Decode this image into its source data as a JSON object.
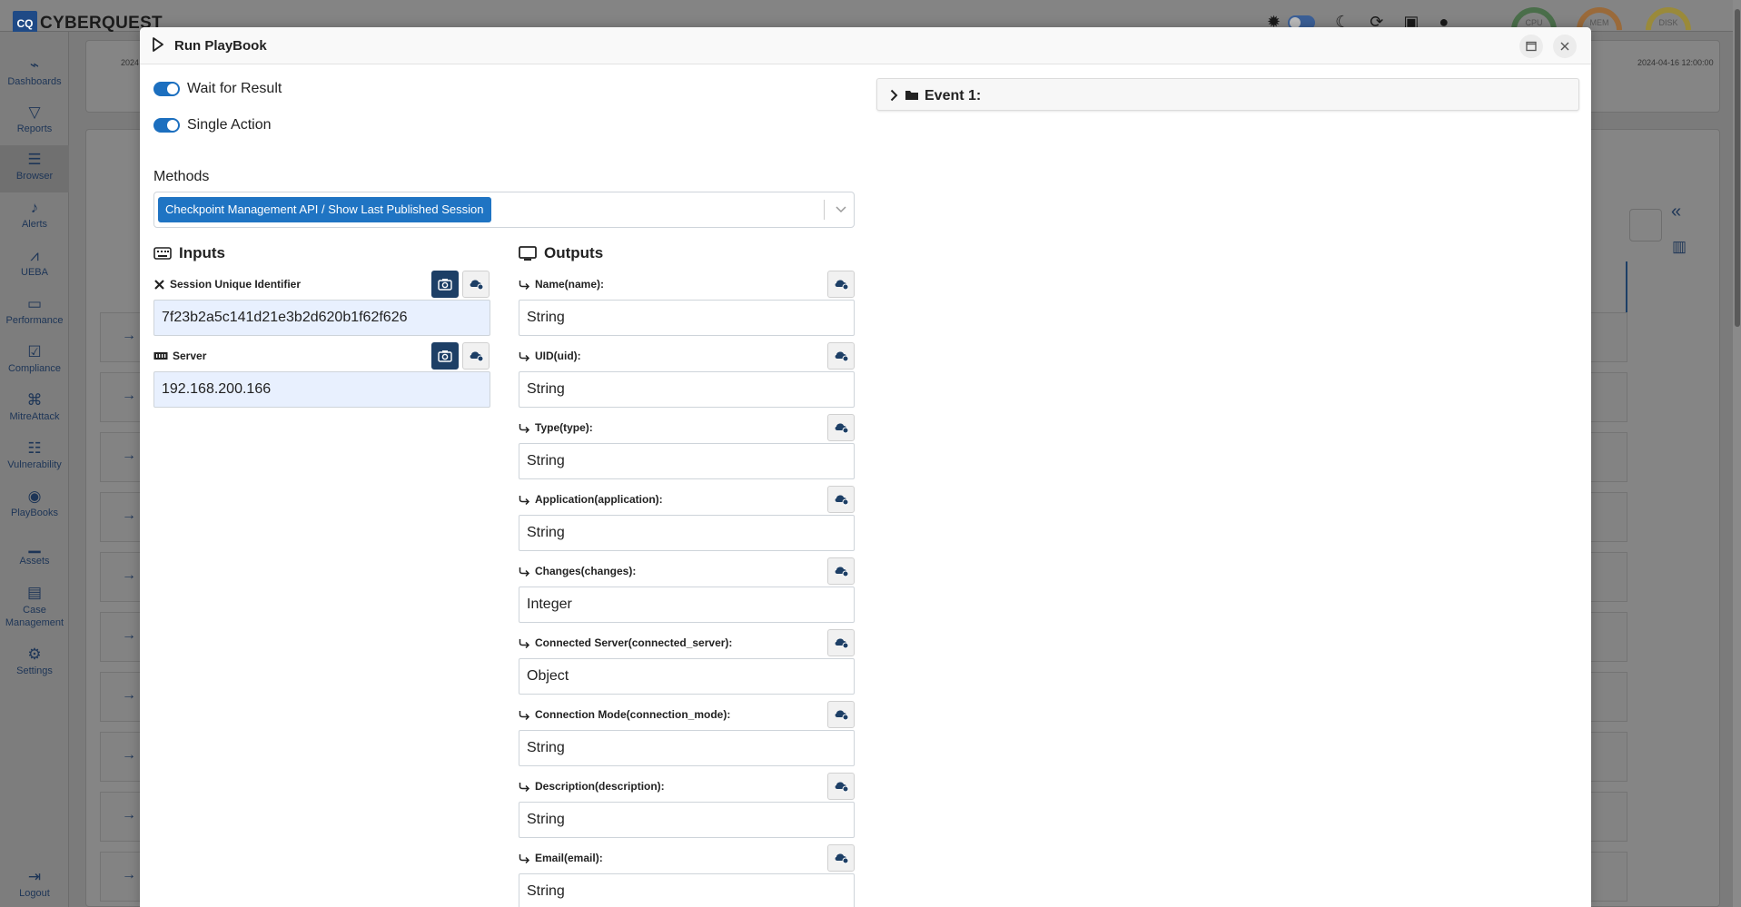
{
  "app": {
    "logo_mark": "CQ",
    "name": "CYBERQUEST",
    "gauges": [
      {
        "label": "CPU",
        "min": "",
        "max": "100",
        "color": "#4caf50"
      },
      {
        "label": "MEM",
        "min": "",
        "max": "100",
        "color": "#e67e22"
      },
      {
        "label": "DISK",
        "min": "0",
        "max": "100",
        "color": "#f1c40f"
      }
    ],
    "bg_dates": {
      "left": "2024",
      "right": "2024-04-16 12:00:00"
    }
  },
  "sidebar": {
    "items": [
      {
        "label": "Dashboards",
        "icon": "dashboards-icon"
      },
      {
        "label": "Reports",
        "icon": "filter-icon"
      },
      {
        "label": "Browser",
        "icon": "list-icon"
      },
      {
        "label": "Alerts",
        "icon": "bell-icon"
      },
      {
        "label": "UEBA",
        "icon": "chart-icon"
      },
      {
        "label": "Performance",
        "icon": "memory-icon"
      },
      {
        "label": "Compliance",
        "icon": "compliance-icon"
      },
      {
        "label": "MitreAttack",
        "icon": "command-icon"
      },
      {
        "label": "Vulnerability",
        "icon": "server-icon"
      },
      {
        "label": "PlayBooks",
        "icon": "playbook-icon"
      },
      {
        "label": "Assets",
        "icon": "laptop-icon"
      },
      {
        "label": "Case Management",
        "icon": "briefcase-icon"
      },
      {
        "label": "Settings",
        "icon": "gear-icon"
      },
      {
        "label": "Logout",
        "icon": "logout-icon"
      }
    ]
  },
  "modal": {
    "title": "Run PlayBook",
    "toggles": [
      {
        "label": "Wait for Result",
        "on": true
      },
      {
        "label": "Single Action",
        "on": true
      }
    ],
    "methods_label": "Methods",
    "selected_method": "Checkpoint Management API / Show Last Published Session",
    "inputs_heading": "Inputs",
    "outputs_heading": "Outputs",
    "inputs": [
      {
        "label": "Session Unique Identifier",
        "icon": "tools-icon",
        "value": "7f23b2a5c141d21e3b2d620b1f62f626"
      },
      {
        "label": "Server",
        "icon": "server-strip-icon",
        "value": "192.168.200.166"
      }
    ],
    "outputs": [
      {
        "label": "Name(name):",
        "value": "String"
      },
      {
        "label": "UID(uid):",
        "value": "String"
      },
      {
        "label": "Type(type):",
        "value": "String"
      },
      {
        "label": "Application(application):",
        "value": "String"
      },
      {
        "label": "Changes(changes):",
        "value": "Integer"
      },
      {
        "label": "Connected Server(connected_server):",
        "value": "Object"
      },
      {
        "label": "Connection Mode(connection_mode):",
        "value": "String"
      },
      {
        "label": "Description(description):",
        "value": "String"
      },
      {
        "label": "Email(email):",
        "value": "String"
      }
    ],
    "event_label": "Event 1:"
  },
  "colors": {
    "accent": "#1f74c3",
    "dark_button": "#1d3f66",
    "filled_input": "#e8f0fe"
  }
}
